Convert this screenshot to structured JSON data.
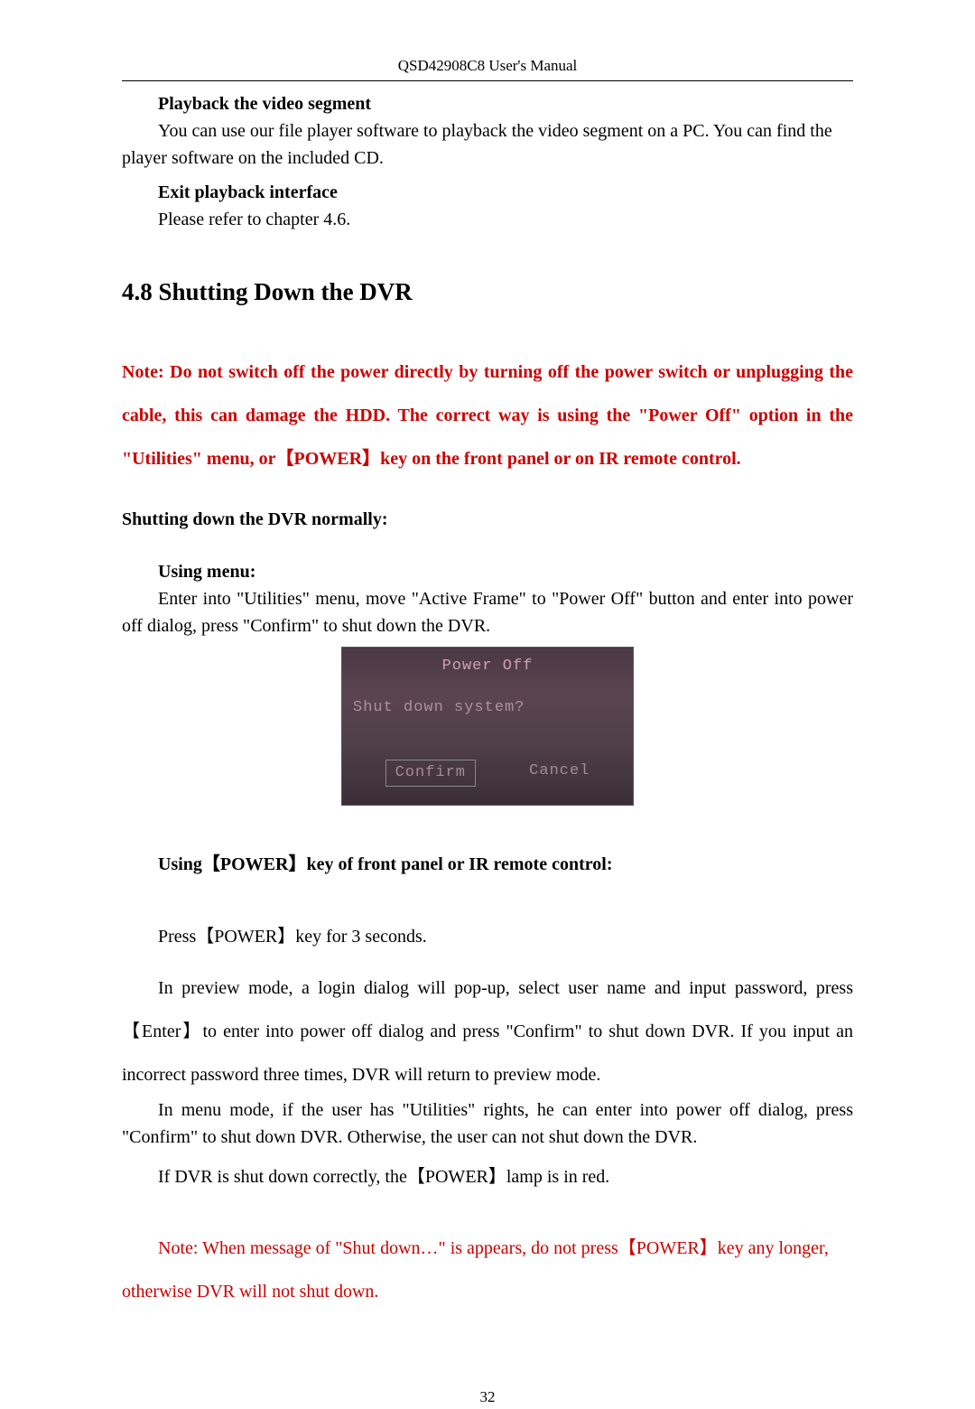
{
  "header": "QSD42908C8 User's Manual",
  "sub1": {
    "heading": "Playback the video segment",
    "body": "You can use our file player software to playback the video segment on a PC. You can find the player software on the included CD."
  },
  "sub2": {
    "heading": "Exit playback interface",
    "body": "Please refer to chapter 4.6."
  },
  "section": {
    "number": "4.8",
    "title": "Shutting Down the DVR"
  },
  "note1": "Note: Do not switch off the power directly by turning off the power switch or unplugging the cable, this can damage the HDD. The correct way is using the \"Power Off\" option in the \"Utilities\" menu, or【POWER】key on the front panel or on IR remote control.",
  "normal_heading": "Shutting down the DVR normally:",
  "using_menu": {
    "heading": "Using menu:",
    "body": "Enter into \"Utilities\" menu, move \"Active Frame\" to \"Power Off\" button and enter into power off dialog, press \"Confirm\" to shut down the DVR."
  },
  "dialog": {
    "title": "Power Off",
    "question": "Shut down system?",
    "confirm": "Confirm",
    "cancel": "Cancel"
  },
  "using_power": {
    "heading": "Using【POWER】key of front panel or IR remote control:",
    "press": "Press【POWER】key for 3 seconds.",
    "preview": "In preview mode, a login dialog will pop-up, select user name and input password, press 【Enter】to enter into power off dialog and press \"Confirm\" to shut down DVR. If you input an incorrect password three times, DVR will return to preview mode.",
    "menu_mode": "In menu mode, if the user has \"Utilities\" rights, he can enter into power off dialog, press \"Confirm\" to shut down DVR. Otherwise, the user can not shut down the DVR.",
    "lamp": "If DVR is shut down correctly, the【POWER】lamp is in red."
  },
  "final_note": "Note: When message of \"Shut down…\" is appears, do not press【POWER】key any longer, otherwise DVR will not shut down.",
  "page_number": "32"
}
